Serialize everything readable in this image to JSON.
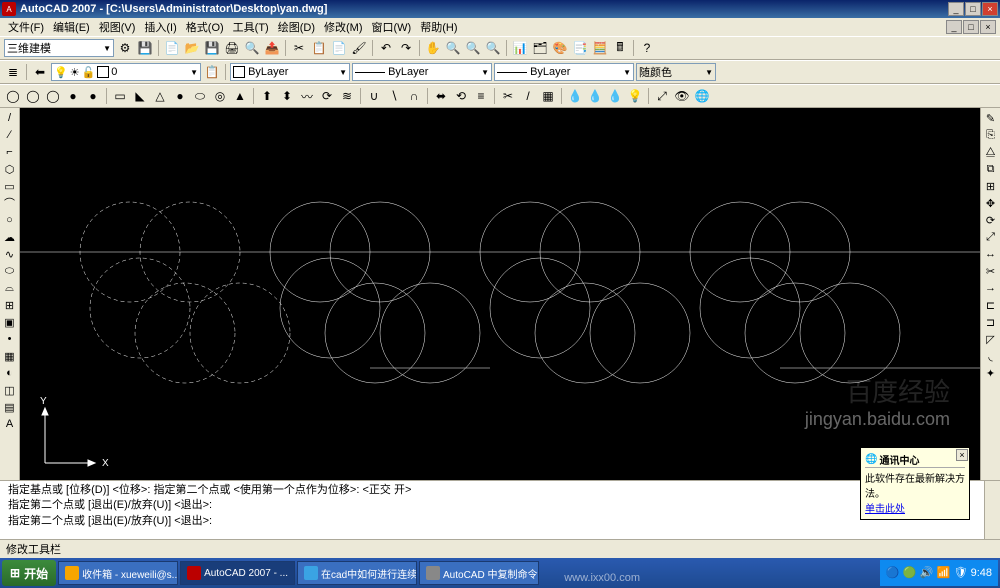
{
  "title": "AutoCAD 2007 - [C:\\Users\\Administrator\\Desktop\\yan.dwg]",
  "menus": [
    "文件(F)",
    "编辑(E)",
    "视图(V)",
    "插入(I)",
    "格式(O)",
    "工具(T)",
    "绘图(D)",
    "修改(M)",
    "窗口(W)",
    "帮助(H)"
  ],
  "workspace_select": "三维建模",
  "layer": {
    "name": "0",
    "bylayer": "ByLayer",
    "linetype": "ByLayer",
    "lineweight": "ByLayer",
    "color_display": "随颜色"
  },
  "cmd_lines": [
    "指定基点或 [位移(D)] <位移>:   指定第二个点或 <使用第一个点作为位移>:   <正交 开>",
    "指定第二个点或 [退出(E)/放弃(U)] <退出>:",
    "指定第二个点或 [退出(E)/放弃(U)] <退出>:"
  ],
  "status_label": "修改工具栏",
  "popup": {
    "title": "通讯中心",
    "body": "此软件存在最新解决方法。",
    "link": "单击此处"
  },
  "taskbar": {
    "start": "开始",
    "items": [
      {
        "label": "收件箱 - xueweili@s...",
        "active": false,
        "color": "#f7a500"
      },
      {
        "label": "AutoCAD 2007 - ...",
        "active": true,
        "color": "#b00"
      },
      {
        "label": "在cad中如何进行连续...",
        "active": false,
        "color": "#3aa3e3"
      },
      {
        "label": "AutoCAD 中复制命令...",
        "active": false,
        "color": "#888"
      }
    ],
    "clock": "9:48"
  },
  "url": "www.ixx00.com",
  "watermark": {
    "line1": "",
    "line2": "jingyan.baidu.com"
  },
  "axis": {
    "x": "X",
    "y": "Y"
  }
}
